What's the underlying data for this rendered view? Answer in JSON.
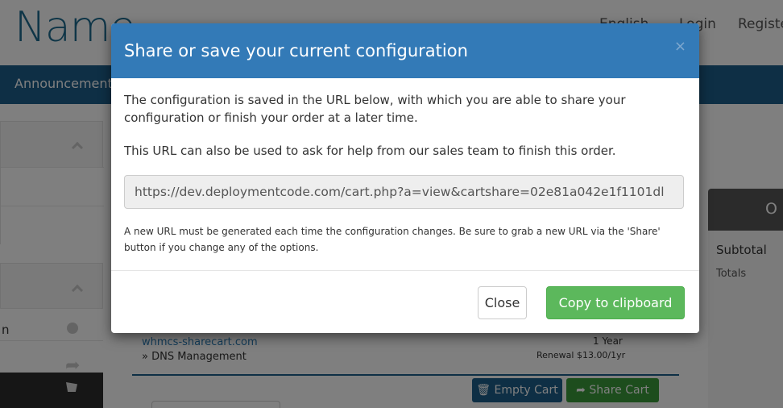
{
  "background": {
    "brand": "Name",
    "top_links": {
      "language": "English",
      "login": "Login",
      "register": "Register"
    },
    "nav": {
      "announcements": "Announcements"
    },
    "sidebar": {
      "item_partial": "n"
    },
    "summary": {
      "heading_partial": "O",
      "subtotal": "Subtotal",
      "totals": "Totals"
    },
    "cart": {
      "domain": "whmcs-sharecart.com",
      "addon": "» DNS Management",
      "term": "1 Year",
      "renewal": "Renewal $13.00/1yr",
      "empty_cart_label": "Empty Cart",
      "share_cart_label": "Share Cart"
    }
  },
  "modal": {
    "title": "Share or save your current configuration",
    "close_symbol": "×",
    "paragraph1": "The configuration is saved in the URL below, with which you are able to share your configuration or finish your order at a later time.",
    "paragraph2": "This URL can also be used to ask for help from our sales team to finish this order.",
    "url_value": "https://dev.deploymentcode.com/cart.php?a=view&cartshare=02e81a042e1f1101dl",
    "note": "A new URL must be generated each time the configuration changes. Be sure to grab a new URL via the 'Share' button if you change any of the options.",
    "close_button": "Close",
    "copy_button": "Copy to clipboard"
  },
  "colors": {
    "header_blue": "#337ab7",
    "nav_blue": "#1c5f8a",
    "success_green": "#5cb85c",
    "overlay": "rgba(0,0,0,0.5)"
  },
  "icons": [
    "close-icon",
    "chevron-up-icon",
    "globe-icon",
    "share-icon",
    "cart-icon",
    "trash-icon"
  ]
}
